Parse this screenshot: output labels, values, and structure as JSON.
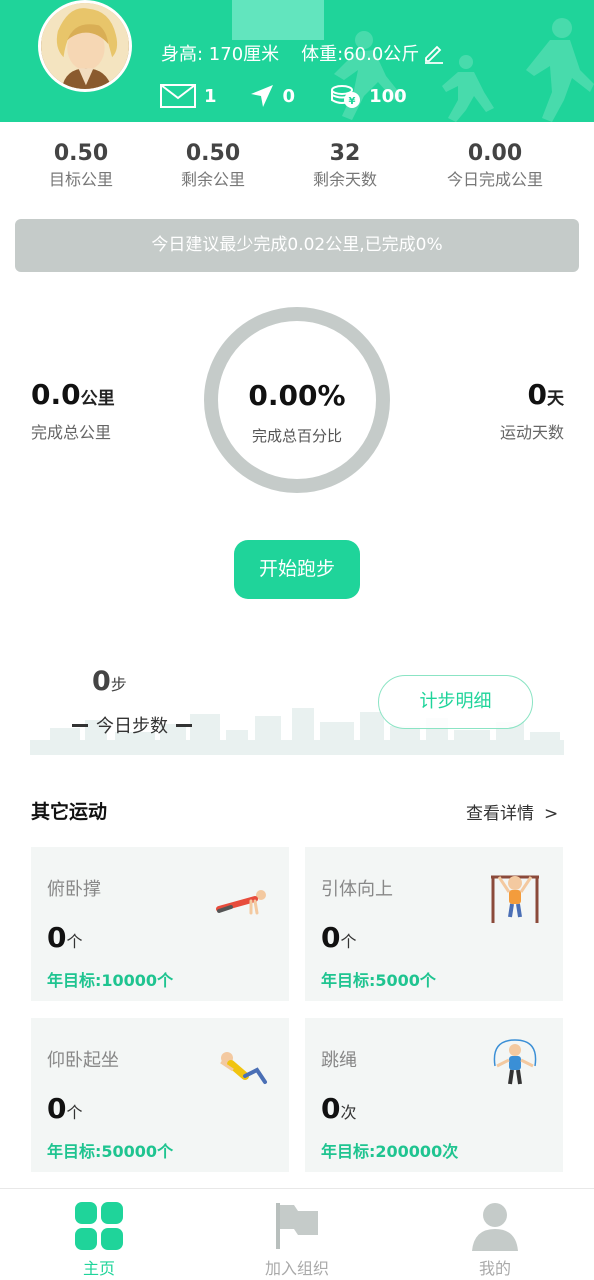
{
  "header": {
    "height_text": "身高: 170厘米",
    "weight_text": "体重:60.0公斤",
    "messages": "1",
    "location": "0",
    "coins": "100"
  },
  "stats": [
    {
      "value": "0.50",
      "label": "目标公里"
    },
    {
      "value": "0.50",
      "label": "剩余公里"
    },
    {
      "value": "32",
      "label": "剩余天数"
    },
    {
      "value": "0.00",
      "label": "今日完成公里"
    }
  ],
  "suggestion": "今日建议最少完成0.02公里,已完成0%",
  "progress": {
    "total_km": "0.0",
    "total_km_unit": "公里",
    "total_km_label": "完成总公里",
    "percent": "0.00%",
    "percent_label": "完成总百分比",
    "days": "0",
    "days_unit": "天",
    "days_label": "运动天数"
  },
  "start_button": "开始跑步",
  "steps": {
    "value": "0",
    "unit": "步",
    "label": "今日步数",
    "detail_button": "计步明细"
  },
  "other": {
    "title": "其它运动",
    "more": "查看详情",
    "more_chevron": ">",
    "cards": [
      {
        "name": "俯卧撑",
        "count": "0",
        "unit": "个",
        "goal": "年目标:10000个",
        "icon": "pushup-icon"
      },
      {
        "name": "引体向上",
        "count": "0",
        "unit": "个",
        "goal": "年目标:5000个",
        "icon": "pullup-icon"
      },
      {
        "name": "仰卧起坐",
        "count": "0",
        "unit": "个",
        "goal": "年目标:50000个",
        "icon": "situp-icon"
      },
      {
        "name": "跳绳",
        "count": "0",
        "unit": "次",
        "goal": "年目标:200000次",
        "icon": "jumprope-icon"
      }
    ]
  },
  "tabs": [
    {
      "label": "主页",
      "icon": "home-grid-icon",
      "active": true
    },
    {
      "label": "加入组织",
      "icon": "flag-icon",
      "active": false
    },
    {
      "label": "我的",
      "icon": "person-icon",
      "active": false
    }
  ],
  "colors": {
    "accent": "#1fd49a",
    "ring": "#c5cbc9",
    "card_bg": "#f3f6f5"
  }
}
